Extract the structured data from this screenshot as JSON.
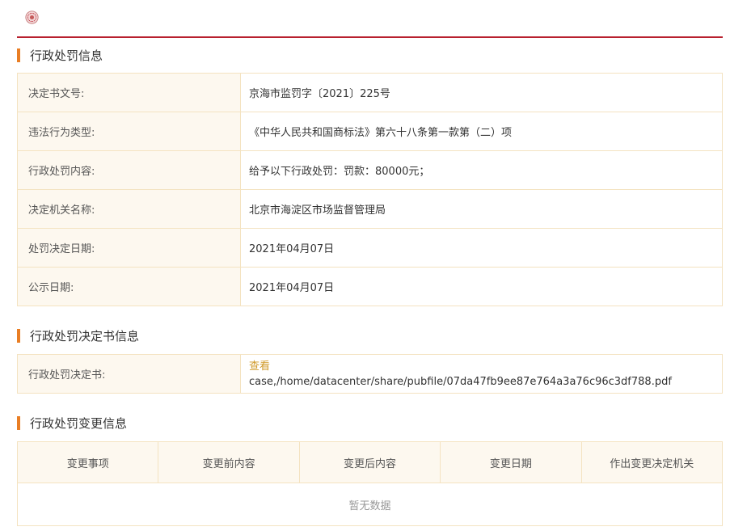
{
  "sections": {
    "info_title": "行政处罚信息",
    "doc_title": "行政处罚决定书信息",
    "change_title": "行政处罚变更信息"
  },
  "info_rows": [
    {
      "label": "决定书文号:",
      "value": "京海市监罚字〔2021〕225号"
    },
    {
      "label": "违法行为类型:",
      "value": "《中华人民共和国商标法》第六十八条第一款第（二）项"
    },
    {
      "label": "行政处罚内容:",
      "value": "给予以下行政处罚：罚款：80000元；"
    },
    {
      "label": "决定机关名称:",
      "value": "北京市海淀区市场监督管理局"
    },
    {
      "label": "处罚决定日期:",
      "value": "2021年04月07日"
    },
    {
      "label": "公示日期:",
      "value": "2021年04月07日"
    }
  ],
  "doc": {
    "label": "行政处罚决定书:",
    "link_text": "查看",
    "path": "case,/home/datacenter/share/pubfile/07da47fb9ee87e764a3a76c96c3df788.pdf"
  },
  "change_table": {
    "headers": [
      "变更事项",
      "变更前内容",
      "变更后内容",
      "变更日期",
      "作出变更决定机关"
    ],
    "empty_text": "暂无数据"
  },
  "colors": {
    "accent_red": "#b8202e",
    "section_marker": "#e97e24",
    "link": "#d09a2a",
    "label_bg": "#fdf8ef",
    "border": "#f4e3c1"
  },
  "icons": {
    "logo": "seal-logo-icon"
  }
}
